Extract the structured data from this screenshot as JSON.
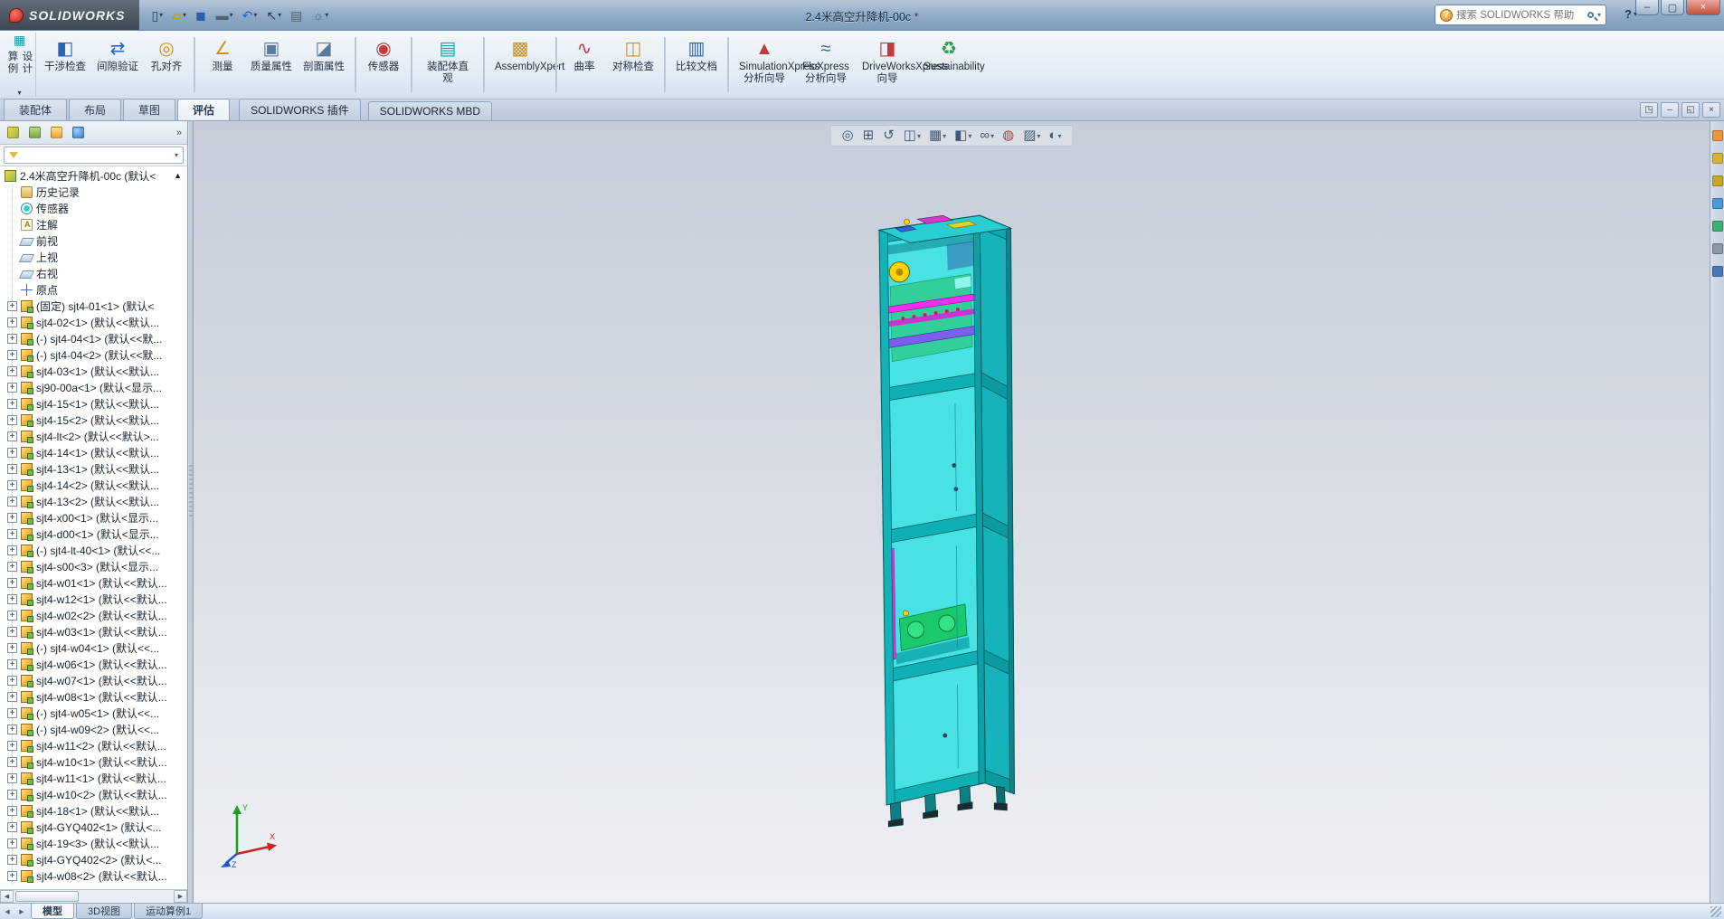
{
  "window": {
    "logo": "SOLIDWORKS",
    "title": "2.4米高空升降机-00c *",
    "search_placeholder": "搜索 SOLIDWORKS 帮助",
    "help": {
      "glyph": "?",
      "arrow": "▾"
    },
    "controls": [
      {
        "name": "minimize-button",
        "glyph": "–"
      },
      {
        "name": "maximize-button",
        "glyph": "▢"
      },
      {
        "name": "close-button",
        "glyph": "×",
        "cls": "close"
      }
    ]
  },
  "quick_access": [
    {
      "name": "new-document-button",
      "glyph": "▯",
      "tone": "q-dark",
      "arrow": "▾"
    },
    {
      "name": "open-document-button",
      "glyph": "▱",
      "tone": "q-amber",
      "arrow": "▾"
    },
    {
      "name": "save-button",
      "glyph": "◼",
      "tone": "q-blue"
    },
    {
      "name": "print-button",
      "glyph": "▬",
      "tone": "q-gray",
      "arrow": "▾"
    },
    {
      "name": "undo-button",
      "glyph": "↶",
      "tone": "q-blue",
      "arrow": "▾"
    },
    {
      "name": "select-tool-button",
      "glyph": "↖",
      "tone": "q-dark",
      "arrow": "▾"
    },
    {
      "name": "file-properties-button",
      "glyph": "▤",
      "tone": "q-gray"
    },
    {
      "name": "options-button",
      "glyph": "☼",
      "tone": "q-gray",
      "arrow": "▾"
    }
  ],
  "ribbon": {
    "design_study": {
      "label": "设计算例",
      "glyph": "▦",
      "arrow": "▾"
    },
    "buttons": [
      {
        "type": "btn",
        "label": "干涉检查",
        "glyph": "◧",
        "tone": "t-blue"
      },
      {
        "type": "btn",
        "label": "间隙验证",
        "glyph": "⇄",
        "tone": "t-blue"
      },
      {
        "type": "btn",
        "label": "孔对齐",
        "glyph": "◎",
        "tone": "t-gold"
      },
      {
        "type": "sep"
      },
      {
        "type": "btn",
        "label": "测量",
        "glyph": "∠",
        "tone": "t-gold"
      },
      {
        "type": "btn",
        "label": "质量属性",
        "glyph": "▣",
        "tone": "t-steel"
      },
      {
        "type": "btn",
        "label": "剖面属性",
        "glyph": "◪",
        "tone": "t-steel"
      },
      {
        "type": "sep"
      },
      {
        "type": "btn",
        "label": "传感器",
        "glyph": "◉",
        "tone": "t-red"
      },
      {
        "type": "sep"
      },
      {
        "type": "btn",
        "label": "装配体直观",
        "glyph": "▤",
        "tone": "t-cyan"
      },
      {
        "type": "sep"
      },
      {
        "type": "btn",
        "label": "AssemblyXpert",
        "glyph": "▩",
        "tone": "t-gold",
        "wide": "wide"
      },
      {
        "type": "sep"
      },
      {
        "type": "btn",
        "label": "曲率",
        "glyph": "∿",
        "tone": "t-red"
      },
      {
        "type": "btn",
        "label": "对称检查",
        "glyph": "◫",
        "tone": "t-gold"
      },
      {
        "type": "sep"
      },
      {
        "type": "btn",
        "label": "比较文档",
        "glyph": "▥",
        "tone": "t-blue"
      },
      {
        "type": "sep"
      },
      {
        "type": "btn",
        "label": "SimulationXpress 分析向导",
        "glyph": "▲",
        "tone": "t-red",
        "wide": "wide"
      },
      {
        "type": "btn",
        "label": "FloXpress 分析向导",
        "glyph": "≈",
        "tone": "t-blue",
        "wide": "wide"
      },
      {
        "type": "btn",
        "label": "DriveWorksXpress 向导",
        "glyph": "◨",
        "tone": "t-red",
        "wide": "wide"
      },
      {
        "type": "btn",
        "label": "Sustainability",
        "glyph": "♻",
        "tone": "t-green",
        "wide": "wide"
      }
    ]
  },
  "command_tabs": {
    "tabs": [
      {
        "label": "装配体"
      },
      {
        "label": "布局"
      },
      {
        "label": "草图"
      },
      {
        "label": "评估",
        "cls": "active"
      }
    ],
    "addins": [
      {
        "label": "SOLIDWORKS 插件"
      },
      {
        "label": "SOLIDWORKS MBD"
      }
    ],
    "doc_controls": [
      {
        "name": "document-new-window-button",
        "glyph": "◳"
      },
      {
        "name": "document-minimize-button",
        "glyph": "–"
      },
      {
        "name": "document-restore-button",
        "glyph": "◱"
      },
      {
        "name": "document-close-button",
        "glyph": "×"
      }
    ]
  },
  "panel": {
    "manager_tabs": [
      {
        "name": "featuremanager-tab",
        "cls": "mt1"
      },
      {
        "name": "propertymanager-tab",
        "cls": "mt2"
      },
      {
        "name": "configurationmanager-tab",
        "cls": "mt3"
      },
      {
        "name": "displaymanager-tab",
        "cls": "mt4"
      }
    ],
    "more_glyph": "»",
    "filter_arrow": "▾",
    "scroll": {
      "left": "◀",
      "right": "▶"
    },
    "tree": {
      "root": "2.4米高空升降机-00c (默认<",
      "collapse_glyph": "▲",
      "items": [
        {
          "cls": "sys",
          "expcls": "off",
          "icon": "hist",
          "label": "历史记录"
        },
        {
          "cls": "sys",
          "expcls": "off",
          "icon": "sensor",
          "label": "传感器"
        },
        {
          "cls": "sys",
          "expcls": "off",
          "icon": "ann",
          "label": "注解"
        },
        {
          "cls": "sys",
          "expcls": "off",
          "icon": "plane",
          "label": "前视"
        },
        {
          "cls": "sys",
          "expcls": "off",
          "icon": "plane",
          "label": "上视"
        },
        {
          "cls": "sys",
          "expcls": "off",
          "icon": "plane",
          "label": "右视"
        },
        {
          "cls": "sys",
          "expcls": "off",
          "icon": "origin",
          "label": "原点"
        },
        {
          "cls": "part",
          "exp": "+",
          "expcls": "on",
          "icon": "part",
          "label": "(固定) sjt4-01<1> (默认<"
        },
        {
          "cls": "part",
          "exp": "+",
          "expcls": "on",
          "icon": "part",
          "label": "sjt4-02<1> (默认<<默认..."
        },
        {
          "cls": "part",
          "exp": "+",
          "expcls": "on",
          "icon": "part",
          "label": "(-) sjt4-04<1> (默认<<默..."
        },
        {
          "cls": "part",
          "exp": "+",
          "expcls": "on",
          "icon": "part",
          "label": "(-) sjt4-04<2> (默认<<默..."
        },
        {
          "cls": "part",
          "exp": "+",
          "expcls": "on",
          "icon": "part",
          "label": "sjt4-03<1> (默认<<默认..."
        },
        {
          "cls": "part",
          "exp": "+",
          "expcls": "on",
          "icon": "part",
          "label": "sj90-00a<1> (默认<显示..."
        },
        {
          "cls": "part",
          "exp": "+",
          "expcls": "on",
          "icon": "part",
          "label": "sjt4-15<1> (默认<<默认..."
        },
        {
          "cls": "part",
          "exp": "+",
          "expcls": "on",
          "icon": "part",
          "label": "sjt4-15<2> (默认<<默认..."
        },
        {
          "cls": "part",
          "exp": "+",
          "expcls": "on",
          "icon": "part",
          "label": "sjt4-lt<2> (默认<<默认>..."
        },
        {
          "cls": "part",
          "exp": "+",
          "expcls": "on",
          "icon": "part",
          "label": "sjt4-14<1> (默认<<默认..."
        },
        {
          "cls": "part",
          "exp": "+",
          "expcls": "on",
          "icon": "part",
          "label": "sjt4-13<1> (默认<<默认..."
        },
        {
          "cls": "part",
          "exp": "+",
          "expcls": "on",
          "icon": "part",
          "label": "sjt4-14<2> (默认<<默认..."
        },
        {
          "cls": "part",
          "exp": "+",
          "expcls": "on",
          "icon": "part",
          "label": "sjt4-13<2> (默认<<默认..."
        },
        {
          "cls": "part",
          "exp": "+",
          "expcls": "on",
          "icon": "part",
          "label": "sjt4-x00<1> (默认<显示..."
        },
        {
          "cls": "part",
          "exp": "+",
          "expcls": "on",
          "icon": "part",
          "label": "sjt4-d00<1> (默认<显示..."
        },
        {
          "cls": "part",
          "exp": "+",
          "expcls": "on",
          "icon": "part",
          "label": "(-) sjt4-lt-40<1> (默认<<..."
        },
        {
          "cls": "part",
          "exp": "+",
          "expcls": "on",
          "icon": "part",
          "label": "sjt4-s00<3> (默认<显示..."
        },
        {
          "cls": "part",
          "exp": "+",
          "expcls": "on",
          "icon": "part",
          "label": "sjt4-w01<1> (默认<<默认..."
        },
        {
          "cls": "part",
          "exp": "+",
          "expcls": "on",
          "icon": "part",
          "label": "sjt4-w12<1> (默认<<默认..."
        },
        {
          "cls": "part",
          "exp": "+",
          "expcls": "on",
          "icon": "part",
          "label": "sjt4-w02<2> (默认<<默认..."
        },
        {
          "cls": "part",
          "exp": "+",
          "expcls": "on",
          "icon": "part",
          "label": "sjt4-w03<1> (默认<<默认..."
        },
        {
          "cls": "part",
          "exp": "+",
          "expcls": "on",
          "icon": "part",
          "label": "(-) sjt4-w04<1> (默认<<..."
        },
        {
          "cls": "part",
          "exp": "+",
          "expcls": "on",
          "icon": "part",
          "label": "sjt4-w06<1> (默认<<默认..."
        },
        {
          "cls": "part",
          "exp": "+",
          "expcls": "on",
          "icon": "part",
          "label": "sjt4-w07<1> (默认<<默认..."
        },
        {
          "cls": "part",
          "exp": "+",
          "expcls": "on",
          "icon": "part",
          "label": "sjt4-w08<1> (默认<<默认..."
        },
        {
          "cls": "part",
          "exp": "+",
          "expcls": "on",
          "icon": "part",
          "label": "(-) sjt4-w05<1> (默认<<..."
        },
        {
          "cls": "part",
          "exp": "+",
          "expcls": "on",
          "icon": "part",
          "label": "(-) sjt4-w09<2> (默认<<..."
        },
        {
          "cls": "part",
          "exp": "+",
          "expcls": "on",
          "icon": "part",
          "label": "sjt4-w11<2> (默认<<默认..."
        },
        {
          "cls": "part",
          "exp": "+",
          "expcls": "on",
          "icon": "part",
          "label": "sjt4-w10<1> (默认<<默认..."
        },
        {
          "cls": "part",
          "exp": "+",
          "expcls": "on",
          "icon": "part",
          "label": "sjt4-w11<1> (默认<<默认..."
        },
        {
          "cls": "part",
          "exp": "+",
          "expcls": "on",
          "icon": "part",
          "label": "sjt4-w10<2> (默认<<默认..."
        },
        {
          "cls": "part",
          "exp": "+",
          "expcls": "on",
          "icon": "part",
          "label": "sjt4-18<1> (默认<<默认..."
        },
        {
          "cls": "part",
          "exp": "+",
          "expcls": "on",
          "icon": "part",
          "label": "sjt4-GYQ402<1> (默认<..."
        },
        {
          "cls": "part",
          "exp": "+",
          "expcls": "on",
          "icon": "part",
          "label": "sjt4-19<3> (默认<<默认..."
        },
        {
          "cls": "part",
          "exp": "+",
          "expcls": "on",
          "icon": "part",
          "label": "sjt4-GYQ402<2> (默认<..."
        },
        {
          "cls": "part",
          "exp": "+",
          "expcls": "on",
          "icon": "part",
          "label": "sjt4-w08<2> (默认<<默认..."
        }
      ]
    }
  },
  "viewport": {
    "hud": [
      {
        "name": "zoom-fit-icon",
        "glyph": "◎"
      },
      {
        "name": "zoom-area-icon",
        "glyph": "⊞"
      },
      {
        "name": "previous-view-icon",
        "glyph": "↺"
      },
      {
        "name": "section-view-icon",
        "glyph": "◫",
        "arrow": "▾"
      },
      {
        "name": "view-orientation-icon",
        "glyph": "▦",
        "arrow": "▾"
      },
      {
        "name": "display-style-icon",
        "glyph": "◧",
        "arrow": "▾"
      },
      {
        "name": "hide-show-items-icon",
        "glyph": "∞",
        "arrow": "▾"
      },
      {
        "name": "edit-appearance-icon",
        "glyph": "◍",
        "tone": "ball"
      },
      {
        "name": "apply-scene-icon",
        "glyph": "▨",
        "arrow": "▾"
      },
      {
        "name": "view-settings-icon",
        "glyph": "◐",
        "arrow": "▾"
      }
    ],
    "triad": {
      "x": "X",
      "y": "Y",
      "z": "Z"
    }
  },
  "task_pane": [
    {
      "name": "solidworks-resources-icon",
      "tone": "tp-orange"
    },
    {
      "name": "design-library-icon",
      "tone": "tp-amber"
    },
    {
      "name": "file-explorer-icon",
      "tone": "tp-gold"
    },
    {
      "name": "view-palette-icon",
      "tone": "tp-skyblue"
    },
    {
      "name": "appearances-scenes-icon",
      "tone": "tp-green"
    },
    {
      "name": "custom-properties-icon",
      "tone": "tp-slate"
    },
    {
      "name": "solidworks-forum-icon",
      "tone": "tp-blue"
    }
  ],
  "statusbar": {
    "scroll_left": "◀",
    "scroll_right": "▶",
    "tabs": [
      {
        "label": "模型",
        "cls": "active"
      },
      {
        "label": "3D视图"
      },
      {
        "label": "运动算例1"
      }
    ]
  },
  "colors": {
    "titlebar": "#8ca7c4",
    "model_cyan": "#46e2e4",
    "frame_teal": "#0fa8ae",
    "panel_green": "#27c46a",
    "magenta": "#e92ee9",
    "viewport_top": "#c6cdd8",
    "viewport_bottom": "#eef0f4"
  }
}
